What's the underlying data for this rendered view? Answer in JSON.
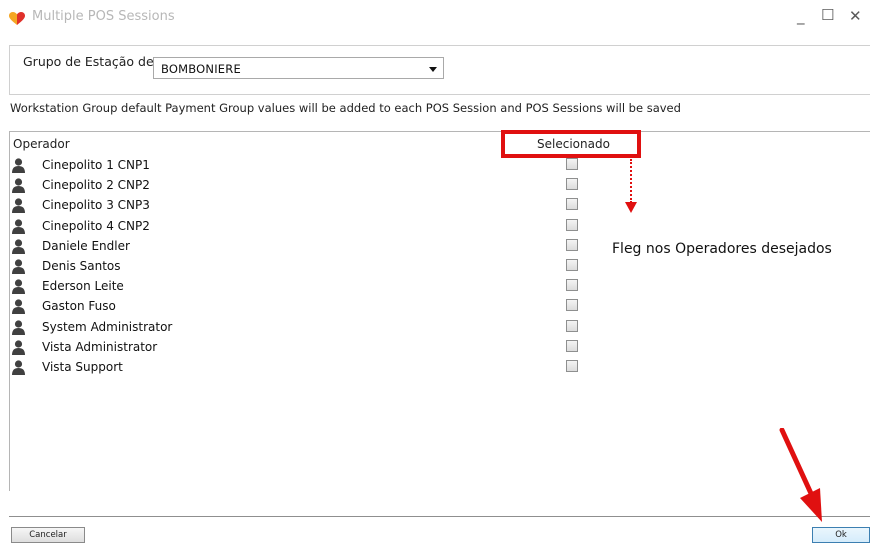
{
  "window": {
    "title": "Multiple POS Sessions",
    "controls": [
      "minimize",
      "maximize",
      "close"
    ],
    "min_glyph": "_",
    "max_glyph": "☐",
    "close_glyph": "✕",
    "logo_icon": "heart-logo-icon",
    "logo_colors": [
      "#f5a623",
      "#e0312b"
    ]
  },
  "group": {
    "label": "Grupo de Estação de",
    "selected": "BOMBONIERE"
  },
  "info_text": "Workstation Group default Payment Group values will be added to each POS Session and POS Sessions will be saved",
  "grid": {
    "columns": {
      "operador": "Operador",
      "selecionado": "Selecionado"
    },
    "rows": [
      {
        "name": "Cinepolito 1 CNP1",
        "selected": false
      },
      {
        "name": "Cinepolito 2 CNP2",
        "selected": false
      },
      {
        "name": "Cinepolito 3 CNP3",
        "selected": false
      },
      {
        "name": "Cinepolito 4 CNP2",
        "selected": false
      },
      {
        "name": "Daniele Endler",
        "selected": false
      },
      {
        "name": "Denis Santos",
        "selected": false
      },
      {
        "name": "Ederson Leite",
        "selected": false
      },
      {
        "name": "Gaston Fuso",
        "selected": false
      },
      {
        "name": "System Administrator",
        "selected": false
      },
      {
        "name": "Vista Administrator",
        "selected": false
      },
      {
        "name": "Vista Support",
        "selected": false
      }
    ]
  },
  "annotation": {
    "text": "Fleg nos Operadores desejados",
    "color": "#e01010"
  },
  "buttons": {
    "cancel": "Cancelar",
    "ok": "Ok"
  }
}
